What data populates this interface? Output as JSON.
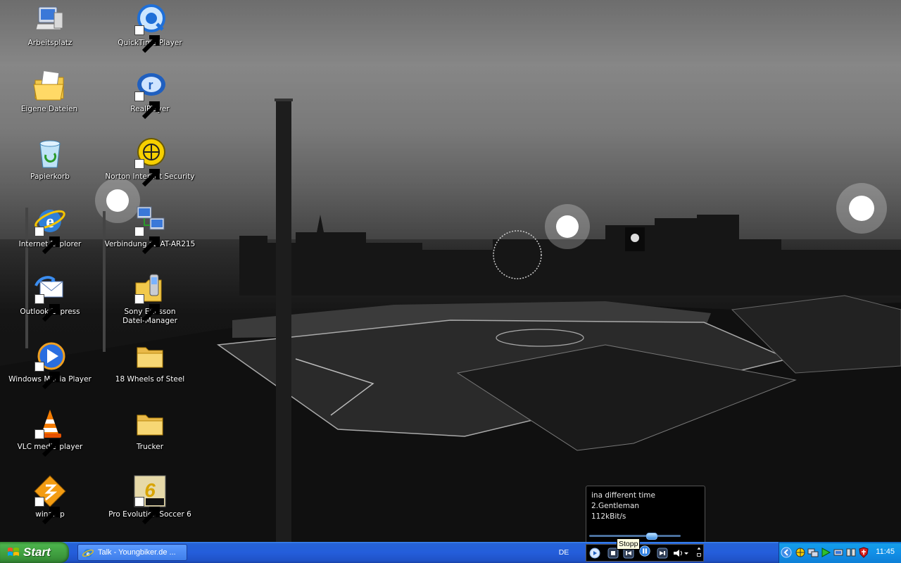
{
  "desktop": {
    "icons": [
      {
        "label": "Arbeitsplatz",
        "icon": "my-computer-icon"
      },
      {
        "label": "Eigene Dateien",
        "icon": "my-documents-icon"
      },
      {
        "label": "Papierkorb",
        "icon": "recycle-bin-icon"
      },
      {
        "label": "Internet Explorer",
        "icon": "internet-explorer-icon"
      },
      {
        "label": "Outlook Express",
        "icon": "outlook-express-icon"
      },
      {
        "label": "Windows Media Player",
        "icon": "windows-media-player-icon"
      },
      {
        "label": "VLC media player",
        "icon": "vlc-icon"
      },
      {
        "label": "winamp",
        "icon": "winamp-icon"
      },
      {
        "label": "QuickTime Player",
        "icon": "quicktime-icon"
      },
      {
        "label": "RealPlayer",
        "icon": "realplayer-icon"
      },
      {
        "label": "Norton Internet Security",
        "icon": "norton-icon"
      },
      {
        "label": "Verbindung zu AT-AR215",
        "icon": "network-connection-icon"
      },
      {
        "label": "Sony Ericsson\nDatei-Manager",
        "icon": "sony-ericsson-icon"
      },
      {
        "label": "18 Wheels of Steel",
        "icon": "folder-icon"
      },
      {
        "label": "Trucker",
        "icon": "folder-icon"
      },
      {
        "label": "Pro Evolution Soccer 6",
        "icon": "pes6-icon"
      }
    ]
  },
  "media_popup": {
    "line1": "ina different time",
    "line2": "2.Gentleman",
    "line3": "112kBit/s",
    "progress": 0.68
  },
  "tooltip": "Stopp",
  "taskbar": {
    "start_label": "Start",
    "task_button": "Talk - Youngbiker.de ...",
    "language": "DE",
    "clock": "11:45"
  },
  "colors": {
    "taskbar_blue": "#245edb",
    "start_green": "#3c983c",
    "tray_blue": "#1290e8"
  }
}
